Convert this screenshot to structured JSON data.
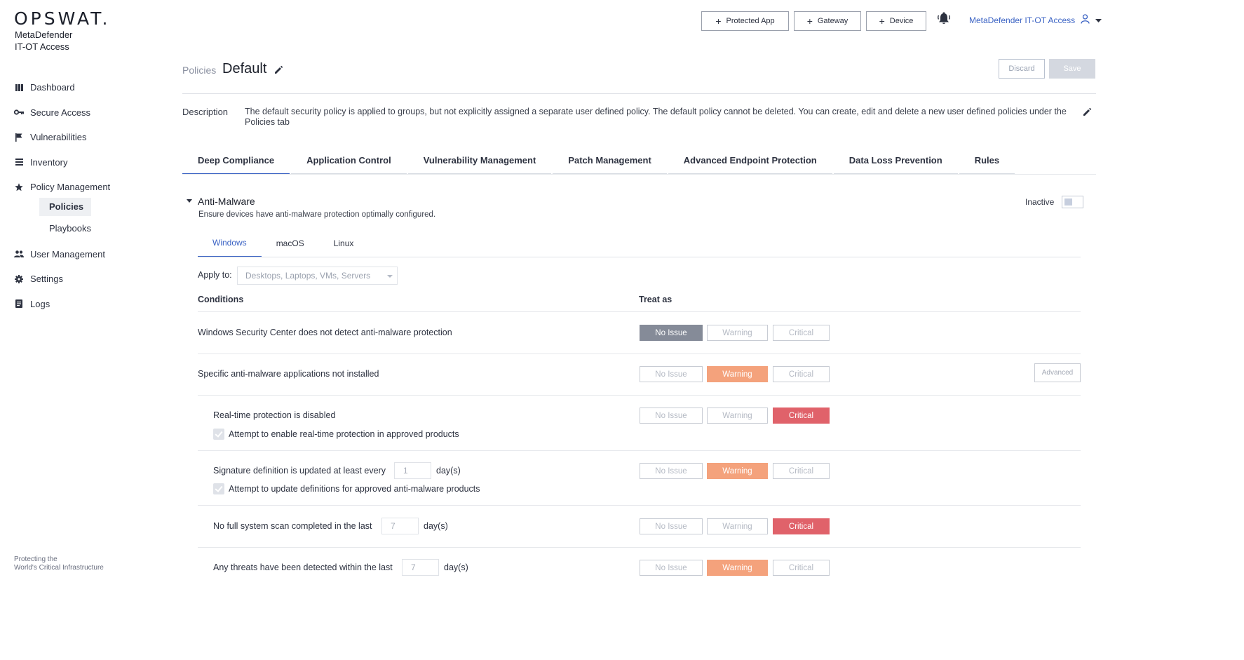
{
  "brand": {
    "logo": "OPSWAT.",
    "product_line1": "MetaDefender",
    "product_line2": "IT-OT Access",
    "footer_line1": "Protecting the",
    "footer_line2": "World's Critical Infrastructure"
  },
  "sidebar": {
    "items": [
      {
        "label": "Dashboard",
        "icon": "bar-chart-icon"
      },
      {
        "label": "Secure Access",
        "icon": "key-icon"
      },
      {
        "label": "Vulnerabilities",
        "icon": "flag-icon"
      },
      {
        "label": "Inventory",
        "icon": "list-icon"
      },
      {
        "label": "Policy Management",
        "icon": "star-icon"
      },
      {
        "label": "User Management",
        "icon": "users-icon"
      },
      {
        "label": "Settings",
        "icon": "gear-icon"
      },
      {
        "label": "Logs",
        "icon": "document-icon"
      }
    ],
    "sub_items": [
      {
        "label": "Policies",
        "active": true
      },
      {
        "label": "Playbooks",
        "active": false
      }
    ]
  },
  "topbar": {
    "protected_app": "Protected App",
    "gateway": "Gateway",
    "device": "Device",
    "user_label": "MetaDefender IT-OT Access"
  },
  "header": {
    "breadcrumb": "Policies",
    "title": "Default",
    "discard": "Discard",
    "save": "Save"
  },
  "description": {
    "label": "Description",
    "text": "The default security policy is applied to groups, but not explicitly assigned a separate user defined policy. The default policy cannot be deleted. You can create, edit and delete a new user defined policies under the Policies tab"
  },
  "tabs": [
    {
      "label": "Deep Compliance",
      "active": true
    },
    {
      "label": "Application Control",
      "active": false
    },
    {
      "label": "Vulnerability Management",
      "active": false
    },
    {
      "label": "Patch Management",
      "active": false
    },
    {
      "label": "Advanced Endpoint Protection",
      "active": false
    },
    {
      "label": "Data Loss Prevention",
      "active": false
    },
    {
      "label": "Rules",
      "active": false
    }
  ],
  "section": {
    "title": "Anti-Malware",
    "subtitle": "Ensure devices have anti-malware protection optimally configured.",
    "status_label": "Inactive",
    "os_tabs": [
      {
        "label": "Windows",
        "active": true
      },
      {
        "label": "macOS",
        "active": false
      },
      {
        "label": "Linux",
        "active": false
      }
    ],
    "apply_to_label": "Apply to:",
    "apply_to_value": "Desktops, Laptops, VMs, Servers",
    "col_conditions": "Conditions",
    "col_treat_as": "Treat as",
    "severity_labels": {
      "no_issue": "No Issue",
      "warning": "Warning",
      "critical": "Critical"
    },
    "advanced_label": "Advanced",
    "rows": [
      {
        "text": "Windows Security Center does not detect anti-malware protection",
        "selected": "no_issue"
      },
      {
        "text": "Specific anti-malware applications not installed",
        "selected": "warning"
      },
      {
        "text": "Real-time protection is disabled",
        "selected": "critical",
        "checkbox": "Attempt to enable real-time protection in approved products"
      },
      {
        "text": "Signature definition is updated at least every",
        "selected": "warning",
        "value": "1",
        "unit": "day(s)",
        "checkbox": "Attempt to update definitions for approved anti-malware products"
      },
      {
        "text": "No full system scan completed in the last",
        "selected": "critical",
        "value": "7",
        "unit": "day(s)"
      },
      {
        "text": "Any threats have been detected within the last",
        "selected": "warning",
        "value": "7",
        "unit": "day(s)"
      }
    ]
  },
  "colors": {
    "accent": "#3b63c4",
    "no_issue": "#858b98",
    "warning": "#f4a27c",
    "critical": "#e0626a"
  }
}
